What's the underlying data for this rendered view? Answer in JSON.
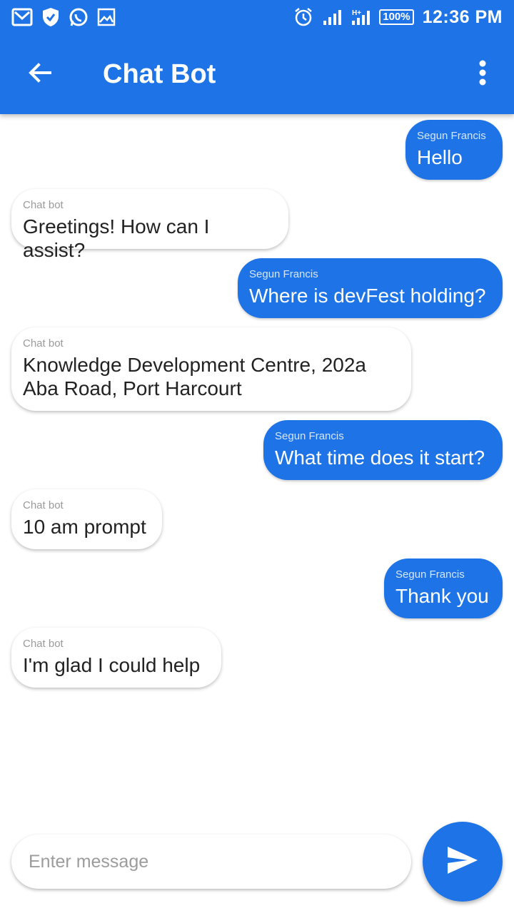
{
  "app": {
    "title": "Chat Bot"
  },
  "status": {
    "time": "12:36 PM",
    "battery": "100%"
  },
  "messages": [
    {
      "sender": "Segun Francis",
      "text": "Hello",
      "role": "user"
    },
    {
      "sender": "Chat bot",
      "text": "Greetings! How can I assist?",
      "role": "bot"
    },
    {
      "sender": "Segun Francis",
      "text": "Where is devFest holding?",
      "role": "user"
    },
    {
      "sender": "Chat bot",
      "text": "Knowledge Development Centre, 202a Aba Road, Port Harcourt",
      "role": "bot"
    },
    {
      "sender": "Segun Francis",
      "text": "What time does it start?",
      "role": "user"
    },
    {
      "sender": "Chat bot",
      "text": "10 am prompt",
      "role": "bot"
    },
    {
      "sender": "Segun Francis",
      "text": "Thank you",
      "role": "user"
    },
    {
      "sender": "Chat bot",
      "text": "I'm glad I could help",
      "role": "bot"
    }
  ],
  "composer": {
    "placeholder": "Enter message"
  },
  "colors": {
    "primary": "#1E74E6"
  },
  "icons": {
    "back": "arrow-back-icon",
    "menu": "more-vert-icon",
    "send": "send-icon"
  }
}
